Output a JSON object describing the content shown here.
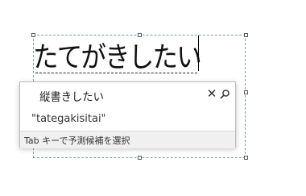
{
  "editor": {
    "composition_text": "たてがきしたい"
  },
  "ime_popup": {
    "candidate": "縦書きしたい",
    "reading": "\"tategakisitai\"",
    "hint": "Tab キーで予測候補を選択",
    "close_icon": "close-icon",
    "search_icon": "search-icon"
  },
  "colors": {
    "frame_border": "#7a9cc7",
    "hint_bar_bg": "#f0f0f0"
  }
}
